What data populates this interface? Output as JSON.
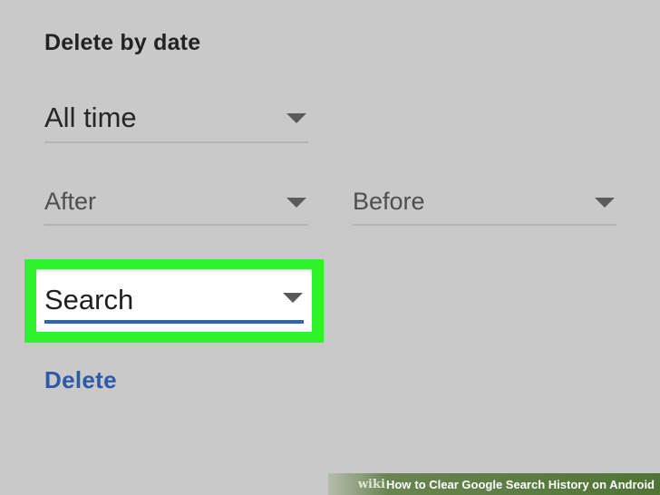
{
  "section": {
    "heading": "Delete by date"
  },
  "range_select": {
    "value": "All time",
    "icon": "dropdown-arrow-icon"
  },
  "after_select": {
    "value": "After",
    "icon": "dropdown-arrow-icon"
  },
  "before_select": {
    "value": "Before",
    "icon": "dropdown-arrow-icon"
  },
  "product_select": {
    "value": "Search",
    "icon": "dropdown-arrow-icon"
  },
  "actions": {
    "delete_label": "Delete"
  },
  "watermark": {
    "brand": "wiki",
    "how": "How",
    "title": "to Clear Google Search History on Android"
  },
  "colors": {
    "background": "#c9c9c9",
    "highlight": "#2ef22b",
    "accent_blue": "#2b62c4",
    "delete_text": "#2b5aa9"
  }
}
